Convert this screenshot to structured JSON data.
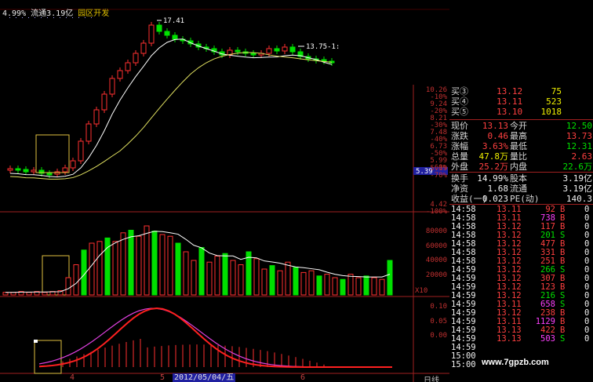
{
  "header": {
    "pct": "4.99%",
    "float_label": "流通",
    "float_value": "3.19亿",
    "concept": "园区开发"
  },
  "price_chart": {
    "high_label": "17.41",
    "last_label": "13.75-1:",
    "current_price_tag": "5.39",
    "right_axis": [
      {
        "price": "10.26",
        "pct": "-10%"
      },
      {
        "price": "9.24",
        "pct": "-20%"
      },
      {
        "price": "8.21",
        "pct": "-30%"
      },
      {
        "price": "7.48",
        "pct": "-40%"
      },
      {
        "price": "6.73",
        "pct": "-50%"
      },
      {
        "price": "5.99",
        "pct": "-60%"
      },
      {
        "price": "5.39",
        "pct": "-70%"
      },
      {
        "price": "4.42",
        "pct": "-100%"
      }
    ]
  },
  "volume_chart": {
    "axis": [
      "80000",
      "60000",
      "40000",
      "20000"
    ],
    "unit": "X10"
  },
  "macd_chart": {
    "axis": [
      "0.10",
      "0.05",
      "0.00"
    ]
  },
  "x_axis": {
    "ticks": [
      "4",
      "5",
      "6"
    ],
    "cursor_date": "2012/05/04/五",
    "period": "日线"
  },
  "quote": {
    "bids": [
      {
        "label": "买③",
        "price": "13.12",
        "vol": "75"
      },
      {
        "label": "买④",
        "price": "13.11",
        "vol": "523"
      },
      {
        "label": "买⑤",
        "price": "13.10",
        "vol": "1018"
      }
    ],
    "stats": [
      {
        "l1": "现价",
        "v1": "13.13",
        "c1": "red",
        "l2": "今开",
        "v2": "12.50",
        "c2": "grn"
      },
      {
        "l1": "涨跌",
        "v1": "0.46",
        "c1": "red",
        "l2": "最高",
        "v2": "13.73",
        "c2": "red"
      },
      {
        "l1": "涨幅",
        "v1": "3.63%",
        "c1": "red",
        "l2": "最低",
        "v2": "12.31",
        "c2": "grn"
      },
      {
        "l1": "总量",
        "v1": "47.8万",
        "c1": "yel",
        "l2": "量比",
        "v2": "2.63",
        "c2": "red"
      },
      {
        "l1": "外盘",
        "v1": "25.2万",
        "c1": "red",
        "l2": "内盘",
        "v2": "22.6万",
        "c2": "grn"
      }
    ],
    "stats2": [
      {
        "l1": "换手",
        "v1": "14.99%",
        "l2": "股本",
        "v2": "3.19亿"
      },
      {
        "l1": "净资",
        "v1": "1.68",
        "l2": "流通",
        "v2": "3.19亿"
      },
      {
        "l1": "收益(一)",
        "v1": "0.023",
        "l2": "PE(动)",
        "v2": "140.3"
      }
    ]
  },
  "ticks": [
    {
      "time": "14:58",
      "price": "13.11",
      "vol": "92",
      "side": "B",
      "n": "0",
      "vc": "red"
    },
    {
      "time": "14:58",
      "price": "13.11",
      "vol": "738",
      "side": "B",
      "n": "0",
      "vc": "mag"
    },
    {
      "time": "14:58",
      "price": "13.12",
      "vol": "117",
      "side": "B",
      "n": "0",
      "vc": "red"
    },
    {
      "time": "14:58",
      "price": "13.12",
      "vol": "201",
      "side": "S",
      "n": "0",
      "vc": "grn"
    },
    {
      "time": "14:58",
      "price": "13.12",
      "vol": "477",
      "side": "B",
      "n": "0",
      "vc": "red"
    },
    {
      "time": "14:58",
      "price": "13.12",
      "vol": "331",
      "side": "B",
      "n": "0",
      "vc": "red"
    },
    {
      "time": "14:58",
      "price": "13.12",
      "vol": "251",
      "side": "B",
      "n": "0",
      "vc": "red"
    },
    {
      "time": "14:59",
      "price": "13.12",
      "vol": "266",
      "side": "S",
      "n": "0",
      "vc": "grn"
    },
    {
      "time": "14:59",
      "price": "13.12",
      "vol": "307",
      "side": "B",
      "n": "0",
      "vc": "red"
    },
    {
      "time": "14:59",
      "price": "13.12",
      "vol": "123",
      "side": "B",
      "n": "0",
      "vc": "red"
    },
    {
      "time": "14:59",
      "price": "13.12",
      "vol": "216",
      "side": "S",
      "n": "0",
      "vc": "grn"
    },
    {
      "time": "14:59",
      "price": "13.11",
      "vol": "658",
      "side": "S",
      "n": "0",
      "vc": "mag"
    },
    {
      "time": "14:59",
      "price": "13.12",
      "vol": "238",
      "side": "B",
      "n": "0",
      "vc": "red"
    },
    {
      "time": "14:59",
      "price": "13.11",
      "vol": "1129",
      "side": "B",
      "n": "0",
      "vc": "mag"
    },
    {
      "time": "14:59",
      "price": "13.13",
      "vol": "422",
      "side": "B",
      "n": "0",
      "vc": "red"
    },
    {
      "time": "14:59",
      "price": "13.13",
      "vol": "503",
      "side": "S",
      "n": "0",
      "vc": "mag"
    },
    {
      "time": "14:59",
      "price": "",
      "vol": "",
      "side": "",
      "n": "",
      "vc": "red"
    },
    {
      "time": "15:00",
      "price": "",
      "vol": "",
      "side": "",
      "n": "",
      "vc": "red"
    },
    {
      "time": "15:00",
      "price": "",
      "vol": "",
      "side": "",
      "n": "",
      "vc": "red"
    }
  ],
  "watermark": "www.7gpzb.com",
  "colors": {
    "up": "#ff3030",
    "down": "#00e000",
    "ma_slow": "#e0e060",
    "ma_fast": "#ffffff",
    "box": "#e0c040"
  }
}
